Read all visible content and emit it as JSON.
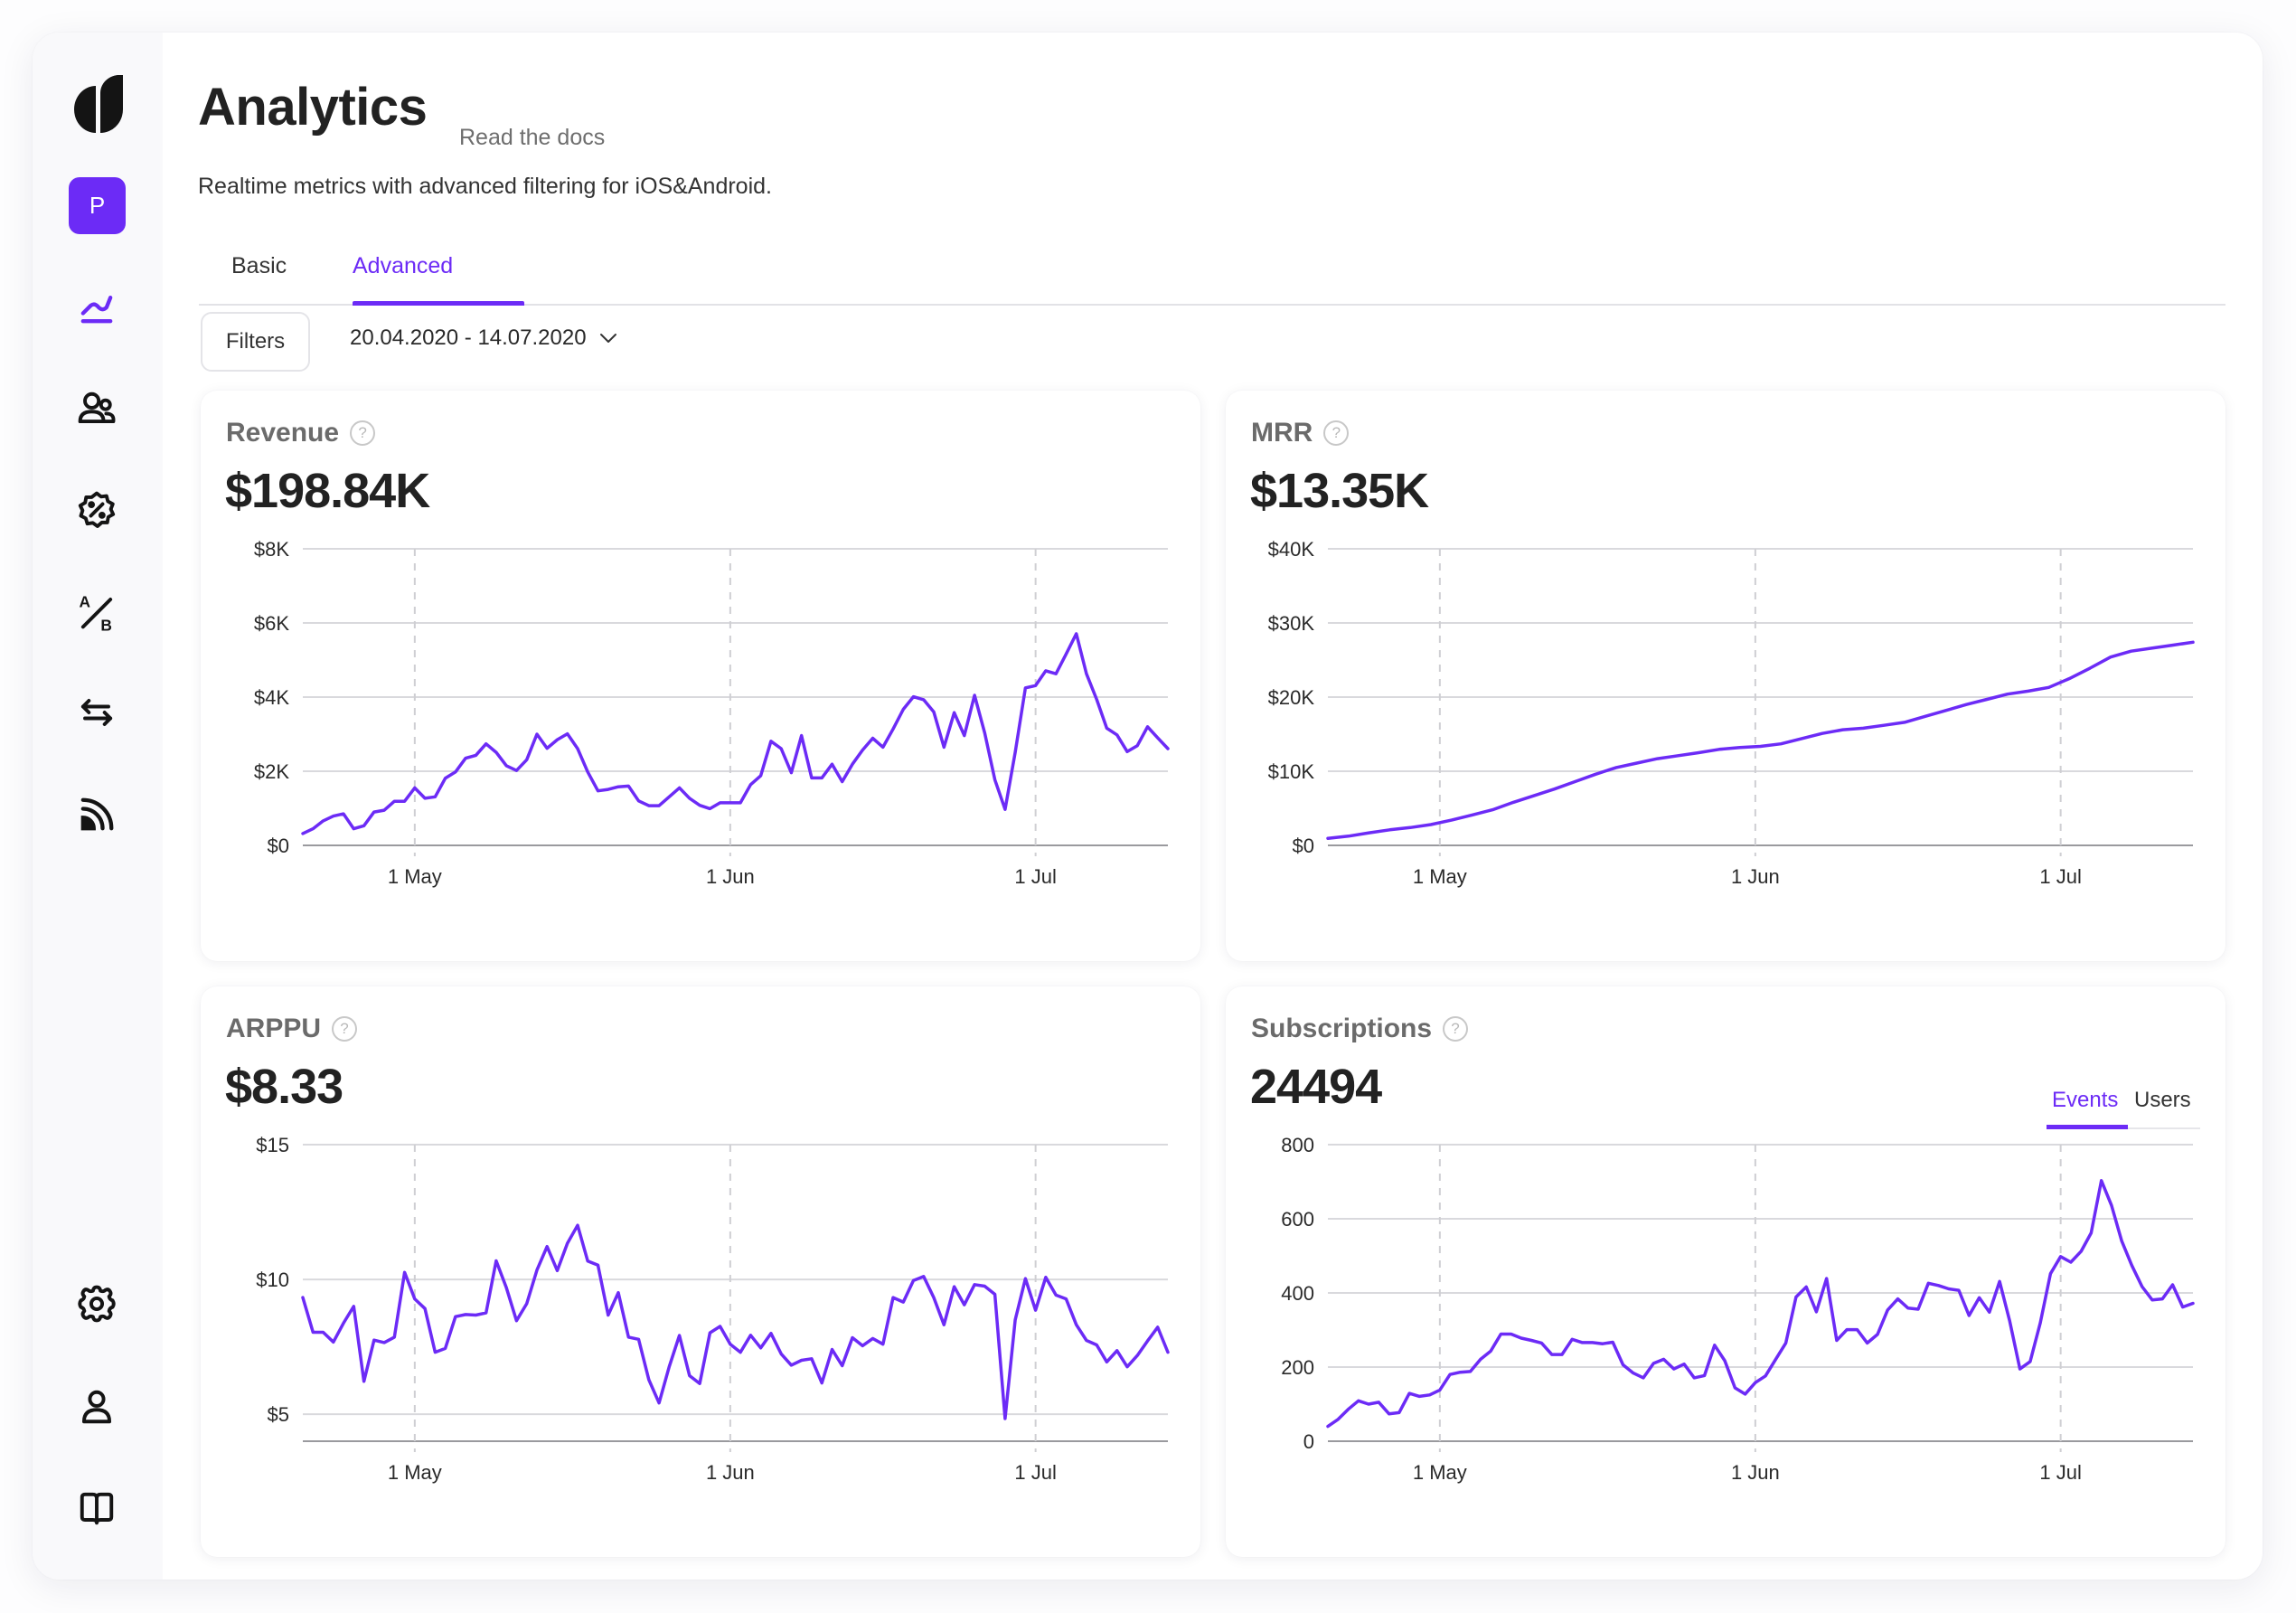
{
  "app": {
    "title": "Analytics",
    "docs_link": "Read the docs",
    "subtitle": "Realtime metrics with advanced filtering for iOS&Android.",
    "avatar_letter": "P",
    "accent_color": "#6c2bf6"
  },
  "sidebar": {
    "items": [
      {
        "name": "analytics",
        "icon": "line-chart-icon",
        "active": true
      },
      {
        "name": "customers",
        "icon": "users-icon"
      },
      {
        "name": "promotions",
        "icon": "percent-badge-icon"
      },
      {
        "name": "ab-tests",
        "icon": "ab-test-icon"
      },
      {
        "name": "integrations",
        "icon": "swap-arrows-icon"
      },
      {
        "name": "feed",
        "icon": "feed-icon"
      }
    ],
    "bottom_items": [
      {
        "name": "settings",
        "icon": "gear-icon"
      },
      {
        "name": "account",
        "icon": "user-icon"
      },
      {
        "name": "docs",
        "icon": "book-icon"
      }
    ]
  },
  "tabs": [
    {
      "label": "Basic",
      "active": false
    },
    {
      "label": "Advanced",
      "active": true
    }
  ],
  "toolbar": {
    "filters_label": "Filters",
    "date_range": "20.04.2020 - 14.07.2020"
  },
  "cards": {
    "revenue": {
      "title": "Revenue",
      "value": "$198.84K"
    },
    "mrr": {
      "title": "MRR",
      "value": "$13.35K"
    },
    "arppu": {
      "title": "ARPPU",
      "value": "$8.33"
    },
    "subscriptions": {
      "title": "Subscriptions",
      "value": "24494",
      "toggle": {
        "options": [
          "Events",
          "Users"
        ],
        "selected": "Events"
      }
    }
  },
  "chart_data": [
    {
      "id": "revenue",
      "type": "line",
      "title": "Revenue",
      "x_start": "2020-04-20",
      "x_end": "2020-07-14",
      "x_ticks": [
        {
          "date": "2020-05-01",
          "label": "1 May"
        },
        {
          "date": "2020-06-01",
          "label": "1 Jun"
        },
        {
          "date": "2020-07-01",
          "label": "1 Jul"
        }
      ],
      "y_ticks": [
        {
          "value": 0,
          "label": "$0"
        },
        {
          "value": 2,
          "label": "$2K"
        },
        {
          "value": 4,
          "label": "$4K"
        },
        {
          "value": 6,
          "label": "$6K"
        },
        {
          "value": 8,
          "label": "$8K"
        }
      ],
      "ylim": [
        0,
        8
      ],
      "yunit": "K USD",
      "grid": true,
      "values": [
        0.32,
        0.45,
        0.66,
        0.79,
        0.85,
        0.45,
        0.53,
        0.9,
        0.95,
        1.19,
        1.19,
        1.55,
        1.27,
        1.31,
        1.81,
        1.98,
        2.35,
        2.43,
        2.74,
        2.51,
        2.15,
        2.02,
        2.31,
        3.0,
        2.62,
        2.85,
        3.01,
        2.61,
        1.98,
        1.47,
        1.51,
        1.58,
        1.6,
        1.2,
        1.07,
        1.07,
        1.31,
        1.55,
        1.27,
        1.08,
        0.99,
        1.15,
        1.15,
        1.15,
        1.64,
        1.88,
        2.81,
        2.61,
        1.96,
        2.96,
        1.82,
        1.82,
        2.19,
        1.72,
        2.19,
        2.57,
        2.89,
        2.65,
        3.14,
        3.67,
        4.01,
        3.93,
        3.6,
        2.65,
        3.58,
        2.96,
        4.05,
        3.04,
        1.77,
        0.97,
        2.51,
        4.25,
        4.31,
        4.71,
        4.63,
        5.16,
        5.71,
        4.63,
        3.94,
        3.16,
        2.98,
        2.53,
        2.69,
        3.2,
        2.9,
        2.61
      ]
    },
    {
      "id": "mrr",
      "type": "line",
      "title": "MRR",
      "x_start": "2020-04-20",
      "x_end": "2020-07-14",
      "x_ticks": [
        {
          "date": "2020-05-01",
          "label": "1 May"
        },
        {
          "date": "2020-06-01",
          "label": "1 Jun"
        },
        {
          "date": "2020-07-01",
          "label": "1 Jul"
        }
      ],
      "y_ticks": [
        {
          "value": 0,
          "label": "$0"
        },
        {
          "value": 10,
          "label": "$10K"
        },
        {
          "value": 20,
          "label": "$20K"
        },
        {
          "value": 30,
          "label": "$30K"
        },
        {
          "value": 40,
          "label": "$40K"
        }
      ],
      "ylim": [
        0,
        40
      ],
      "yunit": "K USD",
      "grid": true,
      "values": [
        0.95,
        1.25,
        1.7,
        2.1,
        2.4,
        2.8,
        3.4,
        4.1,
        4.8,
        5.8,
        6.7,
        7.6,
        8.6,
        9.6,
        10.5,
        11.1,
        11.7,
        12.1,
        12.5,
        12.95,
        13.2,
        13.35,
        13.7,
        14.4,
        15.1,
        15.6,
        15.8,
        16.2,
        16.6,
        17.4,
        18.2,
        19.0,
        19.7,
        20.4,
        20.8,
        21.3,
        22.5,
        23.9,
        25.4,
        26.2,
        26.6,
        27.0,
        27.4
      ]
    },
    {
      "id": "arppu",
      "type": "line",
      "title": "ARPPU",
      "x_start": "2020-04-20",
      "x_end": "2020-07-14",
      "x_ticks": [
        {
          "date": "2020-05-01",
          "label": "1 May"
        },
        {
          "date": "2020-06-01",
          "label": "1 Jun"
        },
        {
          "date": "2020-07-01",
          "label": "1 Jul"
        }
      ],
      "y_ticks": [
        {
          "value": 5,
          "label": "$5"
        },
        {
          "value": 10,
          "label": "$10"
        },
        {
          "value": 15,
          "label": "$15"
        }
      ],
      "ylim": [
        4,
        15
      ],
      "yunit": "USD",
      "grid": true,
      "values": [
        9.33,
        8.04,
        8.04,
        7.68,
        8.38,
        9.0,
        6.22,
        7.75,
        7.66,
        7.86,
        10.26,
        9.28,
        8.92,
        7.3,
        7.44,
        8.62,
        8.7,
        8.68,
        8.76,
        10.69,
        9.69,
        8.47,
        9.1,
        10.35,
        11.22,
        10.33,
        11.34,
        12.01,
        10.68,
        10.53,
        8.68,
        9.51,
        7.86,
        7.78,
        6.28,
        5.42,
        6.76,
        7.92,
        6.43,
        6.14,
        8.02,
        8.26,
        7.6,
        7.3,
        7.93,
        7.46,
        8.0,
        7.24,
        6.82,
        7.0,
        7.06,
        6.16,
        7.4,
        6.8,
        7.84,
        7.54,
        7.81,
        7.6,
        9.33,
        9.16,
        9.96,
        10.11,
        9.33,
        8.32,
        9.73,
        9.06,
        9.81,
        9.75,
        9.45,
        4.84,
        8.5,
        10.03,
        8.86,
        10.08,
        9.42,
        9.28,
        8.32,
        7.74,
        7.57,
        6.94,
        7.36,
        6.76,
        7.18,
        7.72,
        8.23,
        7.3
      ]
    },
    {
      "id": "subscriptions",
      "type": "line",
      "title": "Subscriptions",
      "series_name": "Events",
      "x_start": "2020-04-20",
      "x_end": "2020-07-14",
      "x_ticks": [
        {
          "date": "2020-05-01",
          "label": "1 May"
        },
        {
          "date": "2020-06-01",
          "label": "1 Jun"
        },
        {
          "date": "2020-07-01",
          "label": "1 Jul"
        }
      ],
      "y_ticks": [
        {
          "value": 0,
          "label": "0"
        },
        {
          "value": 200,
          "label": "200"
        },
        {
          "value": 400,
          "label": "400"
        },
        {
          "value": 600,
          "label": "600"
        },
        {
          "value": 800,
          "label": "800"
        }
      ],
      "ylim": [
        0,
        800
      ],
      "yunit": "count",
      "grid": true,
      "values": [
        40,
        59,
        86,
        109,
        100,
        105,
        74,
        77,
        129,
        121,
        125,
        138,
        180,
        186,
        188,
        221,
        243,
        289,
        289,
        278,
        272,
        265,
        234,
        234,
        275,
        266,
        266,
        263,
        267,
        206,
        184,
        171,
        210,
        221,
        195,
        208,
        171,
        177,
        259,
        217,
        144,
        127,
        158,
        176,
        221,
        265,
        389,
        416,
        349,
        439,
        272,
        301,
        301,
        265,
        288,
        354,
        384,
        359,
        356,
        426,
        420,
        411,
        407,
        339,
        387,
        348,
        431,
        324,
        195,
        215,
        319,
        452,
        498,
        483,
        512,
        562,
        703,
        636,
        540,
        474,
        417,
        381,
        384,
        422,
        362,
        372
      ]
    }
  ]
}
